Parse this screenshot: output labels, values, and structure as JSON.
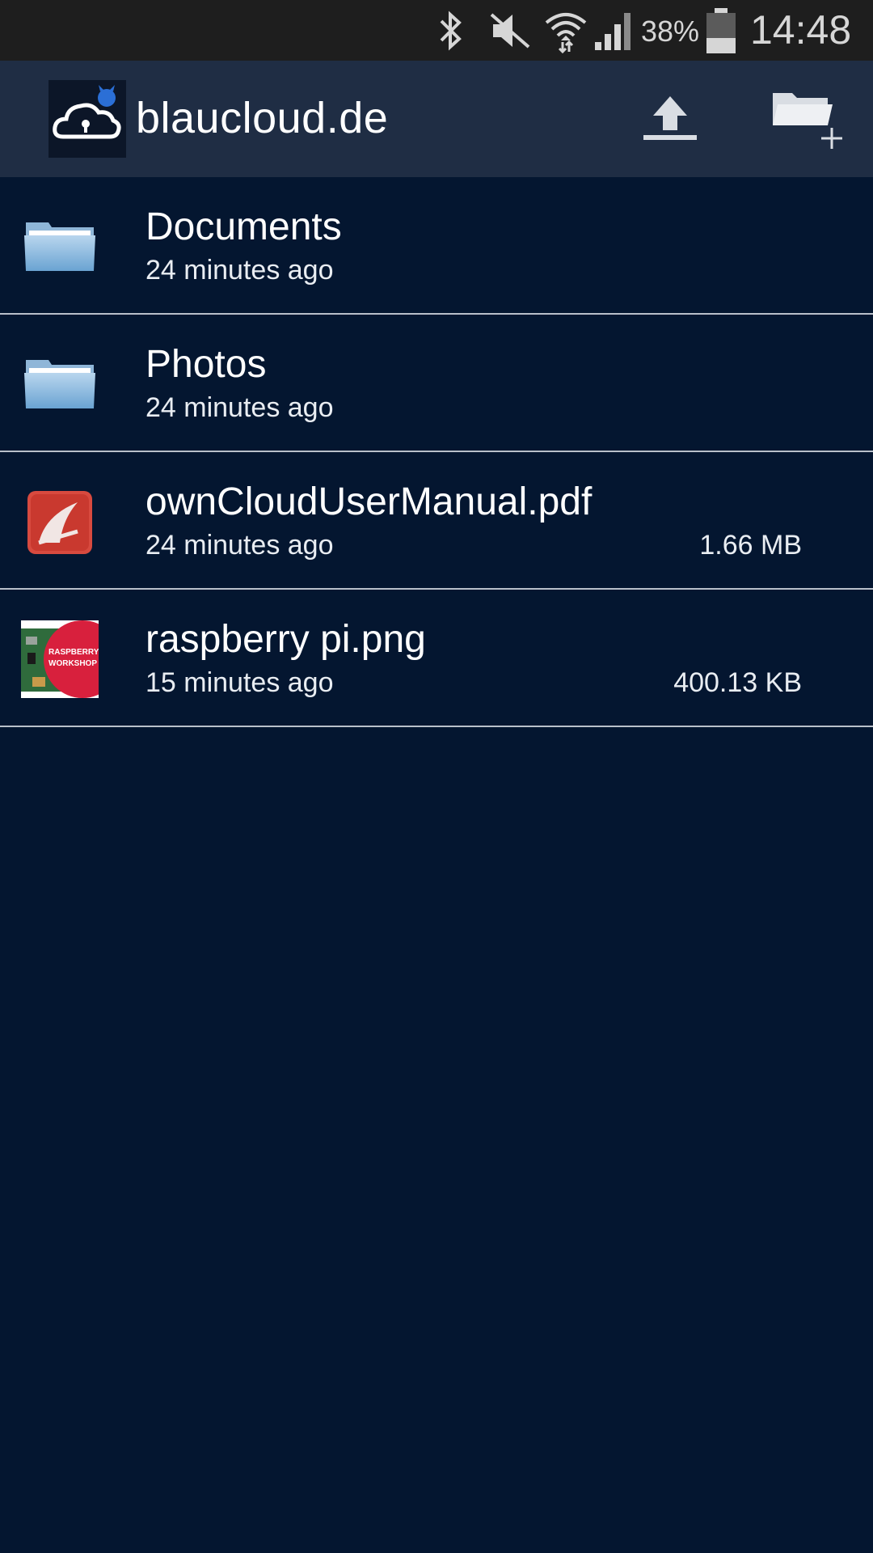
{
  "status_bar": {
    "battery_percent": "38%",
    "time": "14:48",
    "icons": [
      "bluetooth-icon",
      "mute-icon",
      "wifi-icon",
      "signal-icon",
      "battery-icon"
    ],
    "battery_level": 0.38
  },
  "app_bar": {
    "title": "blaucloud.de",
    "logo": "cloud-lock-logo",
    "actions": [
      {
        "name": "upload",
        "icon": "upload-icon"
      },
      {
        "name": "new-folder",
        "icon": "new-folder-icon"
      }
    ]
  },
  "files": [
    {
      "name": "Documents",
      "time": "24 minutes ago",
      "size": "",
      "type": "folder"
    },
    {
      "name": "Photos",
      "time": "24 minutes ago",
      "size": "",
      "type": "folder"
    },
    {
      "name": "ownCloudUserManual.pdf",
      "time": "24 minutes ago",
      "size": "1.66 MB",
      "type": "pdf"
    },
    {
      "name": "raspberry pi.png",
      "time": "15 minutes ago",
      "size": "400.13 KB",
      "type": "image",
      "thumb_text": [
        "RASPBERRY",
        "WORKSHOP"
      ]
    }
  ],
  "colors": {
    "background": "#041630",
    "app_bar": "#1f2d44",
    "status_bar": "#1e1e1e",
    "divider": "#b9c0ca"
  }
}
